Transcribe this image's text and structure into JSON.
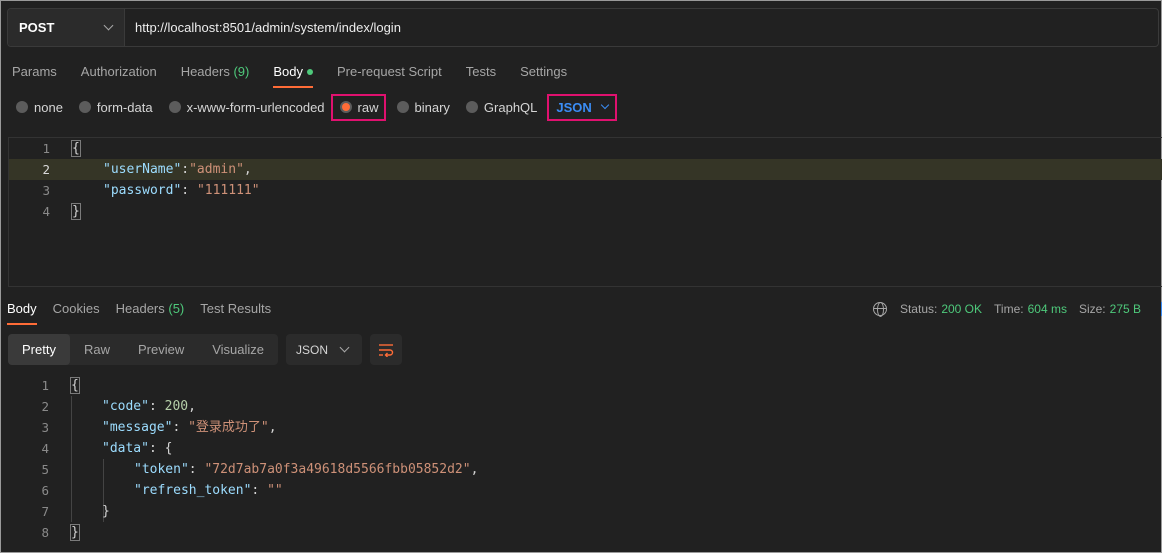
{
  "request": {
    "method": "POST",
    "url": "http://localhost:8501/admin/system/index/login"
  },
  "req_tabs": [
    {
      "label": "Params"
    },
    {
      "label": "Authorization"
    },
    {
      "label": "Headers",
      "count": "(9)"
    },
    {
      "label": "Body"
    },
    {
      "label": "Pre-request Script"
    },
    {
      "label": "Tests"
    },
    {
      "label": "Settings"
    }
  ],
  "body_types": [
    "none",
    "form-data",
    "x-www-form-urlencoded",
    "raw",
    "binary",
    "GraphQL"
  ],
  "body_format": "JSON",
  "request_body": {
    "line_numbers": [
      "1",
      "2",
      "3",
      "4"
    ],
    "open_brace": "{",
    "key1": "\"userName\"",
    "colon1": ":",
    "val1": "\"admin\"",
    "comma1": ",",
    "key2": "\"password\"",
    "colon2": ": ",
    "val2": "\"111111\"",
    "close_brace": "}"
  },
  "res_tabs": [
    {
      "label": "Body"
    },
    {
      "label": "Cookies"
    },
    {
      "label": "Headers",
      "count": "(5)"
    },
    {
      "label": "Test Results"
    }
  ],
  "status": {
    "status_label": "Status:",
    "status_value": "200 OK",
    "time_label": "Time:",
    "time_value": "604 ms",
    "size_label": "Size:",
    "size_value": "275 B"
  },
  "view_modes": [
    "Pretty",
    "Raw",
    "Preview",
    "Visualize"
  ],
  "response_format": "JSON",
  "response_body": {
    "line_numbers": [
      "1",
      "2",
      "3",
      "4",
      "5",
      "6",
      "7",
      "8"
    ],
    "open_brace": "{",
    "code_key": "\"code\"",
    "code_val": "200",
    "message_key": "\"message\"",
    "message_val": "\"登录成功了\"",
    "data_key": "\"data\"",
    "token_key": "\"token\"",
    "token_val": "\"72d7ab7a0f3a49618d5566fbb05852d2\"",
    "refresh_key": "\"refresh_token\"",
    "refresh_val": "\"\"",
    "inner_close": "}",
    "close_brace": "}"
  },
  "colors": {
    "accent": "#ff6c37",
    "success": "#4ec97b",
    "highlight_box": "#e0116f",
    "json_link": "#3b8df5"
  }
}
